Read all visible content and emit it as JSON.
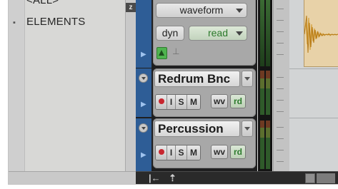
{
  "element_list": {
    "items": [
      "<ALL>",
      "ELEMENTS"
    ],
    "badge": "z"
  },
  "tracks": [
    {
      "mode": "waveform",
      "dyn_label": "dyn",
      "automation": "read"
    },
    {
      "name": "Redrum Bnc",
      "rec": "",
      "input": "I",
      "solo": "S",
      "mute": "M",
      "view_label": "wv",
      "auto_label": "rd"
    },
    {
      "name": "Percussion",
      "rec": "",
      "input": "I",
      "solo": "S",
      "mute": "M",
      "view_label": "wv",
      "auto_label": "rd"
    }
  ],
  "colors": {
    "track_strip": "#2e5d96",
    "record": "#c7262f",
    "clip": "#e8d2a8",
    "waveform": "#d39a2e",
    "automation_green": "#2c7a2c"
  },
  "icons": [
    "play-triangle-icon",
    "collapse-circle-icon",
    "go-to-start-icon",
    "upload-icon",
    "keyframe-icon",
    "pin-icon"
  ]
}
